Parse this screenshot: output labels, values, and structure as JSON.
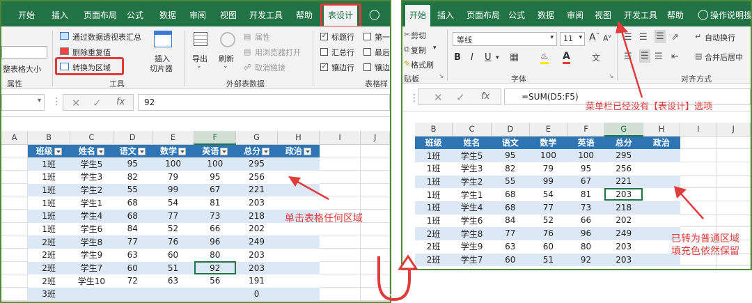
{
  "left": {
    "tabs": [
      "开始",
      "插入",
      "页面布局",
      "公式",
      "数据",
      "审阅",
      "视图",
      "开发工具",
      "帮助",
      "表设计"
    ],
    "selected_tab": "表设计",
    "ribbon": {
      "resize_label": "整表格大小",
      "props_group": "属性",
      "pivot_label": "通过数据透视表汇总",
      "remove_dup_label": "删除重复值",
      "convert_label": "转换为区域",
      "insert_slicer_line1": "插入",
      "insert_slicer_line2": "切片器",
      "tools_group": "工具",
      "export_label": "导出",
      "refresh_label": "刷新",
      "properties_label": "属性",
      "open_browser_label": "用浏览器打开",
      "unlink_label": "取消链接",
      "external_group": "外部表数据",
      "header_row_label": "标题行",
      "total_row_label": "汇总行",
      "banded_rows_label": "镶边行",
      "first_col_label": "第一",
      "last_col_label": "最后",
      "banded_col_label": "镶边",
      "style_options_group": "表格样"
    },
    "formula_value": "92",
    "fx": "fx",
    "col_headers": [
      "A",
      "B",
      "C",
      "D",
      "E",
      "F",
      "G",
      "H",
      "I",
      "J"
    ],
    "table_headers": [
      "班级",
      "姓名",
      "语文",
      "数学",
      "英语",
      "总分",
      "政治"
    ],
    "rows": [
      [
        "1班",
        "学生5",
        "95",
        "100",
        "100",
        "295",
        ""
      ],
      [
        "1班",
        "学生3",
        "82",
        "79",
        "95",
        "256",
        ""
      ],
      [
        "1班",
        "学生2",
        "55",
        "99",
        "67",
        "221",
        ""
      ],
      [
        "1班",
        "学生1",
        "68",
        "54",
        "81",
        "203",
        ""
      ],
      [
        "1班",
        "学生4",
        "68",
        "77",
        "73",
        "218",
        ""
      ],
      [
        "1班",
        "学生6",
        "84",
        "52",
        "66",
        "202",
        ""
      ],
      [
        "2班",
        "学生8",
        "77",
        "76",
        "96",
        "249",
        ""
      ],
      [
        "2班",
        "学生9",
        "63",
        "60",
        "80",
        "203",
        ""
      ],
      [
        "2班",
        "学生7",
        "60",
        "51",
        "92",
        "203",
        ""
      ],
      [
        "2班",
        "学生10",
        "72",
        "63",
        "56",
        "191",
        ""
      ],
      [
        "3班",
        "",
        "",
        "",
        "",
        "0",
        ""
      ]
    ],
    "annotation": "单击表格任何区域"
  },
  "right": {
    "tabs": [
      "开始",
      "插入",
      "页面布局",
      "公式",
      "数据",
      "审阅",
      "视图",
      "开发工具",
      "帮助",
      "操作说明搜"
    ],
    "selected_tab": "开始",
    "ribbon": {
      "cut_label": "剪切",
      "copy_label": "复制",
      "format_painter_label": "格式刷",
      "clipboard_group": "贴板",
      "font_name": "等线",
      "font_size": "11",
      "font_group": "字体",
      "wrap_label": "自动换行",
      "merge_label": "合并后居中",
      "align_group": "对齐方式"
    },
    "formula_value": "=SUM(D5:F5)",
    "fx": "fx",
    "col_headers": [
      "B",
      "C",
      "D",
      "E",
      "F",
      "G",
      "H",
      "I",
      "J"
    ],
    "table_headers": [
      "班级",
      "姓名",
      "语文",
      "数学",
      "英语",
      "总分",
      "政治"
    ],
    "rows": [
      [
        "1班",
        "学生5",
        "95",
        "100",
        "100",
        "295",
        ""
      ],
      [
        "1班",
        "学生3",
        "82",
        "79",
        "95",
        "256",
        ""
      ],
      [
        "1班",
        "学生2",
        "55",
        "99",
        "67",
        "221",
        ""
      ],
      [
        "1班",
        "学生1",
        "68",
        "54",
        "81",
        "203",
        ""
      ],
      [
        "1班",
        "学生4",
        "68",
        "77",
        "73",
        "218",
        ""
      ],
      [
        "1班",
        "学生6",
        "84",
        "52",
        "66",
        "202",
        ""
      ],
      [
        "2班",
        "学生8",
        "77",
        "76",
        "96",
        "249",
        ""
      ],
      [
        "2班",
        "学生9",
        "63",
        "60",
        "80",
        "203",
        ""
      ],
      [
        "2班",
        "学生7",
        "60",
        "51",
        "92",
        "203",
        ""
      ],
      [
        "2班",
        "学生10",
        "72",
        "63",
        "56",
        "191",
        ""
      ],
      [
        "3班",
        "",
        "",
        "",
        "",
        "0",
        ""
      ]
    ],
    "annotation_menu": "菜单栏已经没有【表设计】选项",
    "annotation_region_line1": "已转为普通区域",
    "annotation_region_line2": "填充色依然保留"
  },
  "colors": {
    "excel_green": "#217346",
    "table_header_blue": "#2e75b6",
    "band_blue": "#dde8f6",
    "highlight_red": "#e03c3c",
    "frame_green": "#4f8a3a"
  }
}
